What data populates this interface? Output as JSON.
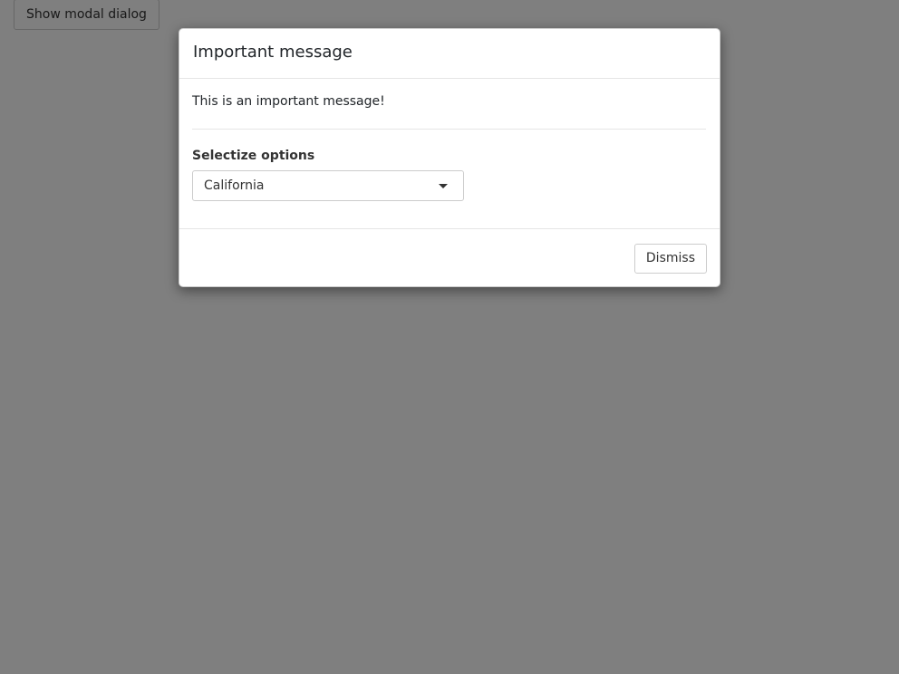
{
  "page": {
    "show_modal_label": "Show modal dialog"
  },
  "modal": {
    "title": "Important message",
    "message": "This is an important message!",
    "field_label": "Selectize options",
    "select_value": "California",
    "dismiss_label": "Dismiss"
  },
  "icons": {
    "select_caret": "chevron-down-icon"
  },
  "colors": {
    "backdrop": "#808080",
    "modal_background": "#ffffff",
    "border": "#cccccc"
  }
}
